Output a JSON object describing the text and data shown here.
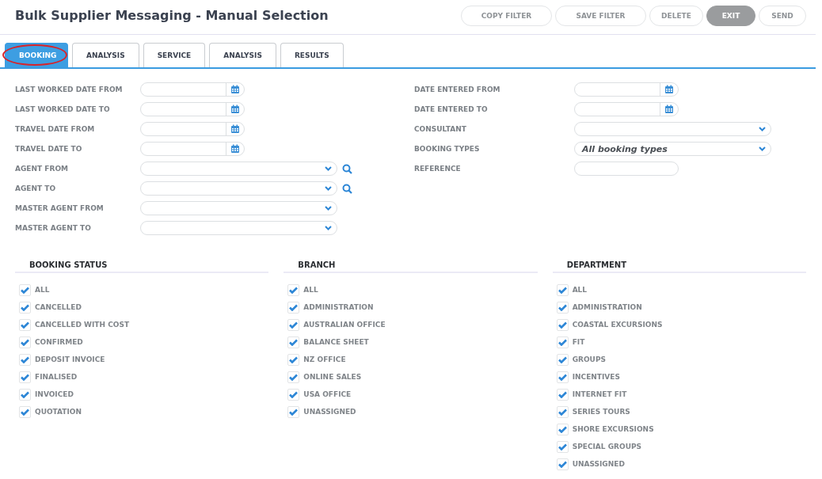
{
  "window": {
    "title": "Bulk Supplier Messaging - Manual Selection"
  },
  "toolbar": [
    {
      "label": "COPY FILTER",
      "kind": "outline"
    },
    {
      "label": "SAVE FILTER",
      "kind": "outline"
    },
    {
      "label": "DELETE",
      "kind": "outline"
    },
    {
      "label": "EXIT",
      "kind": "primary"
    },
    {
      "label": "SEND",
      "kind": "outline"
    }
  ],
  "tabs": [
    {
      "label": "BOOKING",
      "selected": true,
      "circled": true
    },
    {
      "label": "ANALYSIS",
      "selected": false,
      "circled": false
    },
    {
      "label": "SERVICE",
      "selected": false,
      "circled": false
    },
    {
      "label": "ANALYSIS",
      "selected": false,
      "circled": false
    },
    {
      "label": "RESULTS",
      "selected": false,
      "circled": false
    }
  ],
  "form_left": [
    {
      "label": "LAST WORKED DATE FROM",
      "kind": "date"
    },
    {
      "label": "LAST WORKED DATE TO",
      "kind": "date"
    },
    {
      "label": "TRAVEL DATE FROM",
      "kind": "date"
    },
    {
      "label": "TRAVEL DATE TO",
      "kind": "date"
    },
    {
      "label": "AGENT FROM",
      "kind": "lookup"
    },
    {
      "label": "AGENT TO",
      "kind": "lookup"
    },
    {
      "label": "MASTER AGENT FROM",
      "kind": "select"
    },
    {
      "label": "MASTER AGENT TO",
      "kind": "select"
    }
  ],
  "form_right": [
    {
      "label": "DATE ENTERED FROM",
      "kind": "date"
    },
    {
      "label": "DATE ENTERED TO",
      "kind": "date"
    },
    {
      "label": "CONSULTANT",
      "kind": "select"
    },
    {
      "label": "BOOKING TYPES",
      "kind": "select",
      "value": "All booking types"
    },
    {
      "label": "REFERENCE",
      "kind": "text"
    }
  ],
  "groups": [
    {
      "title": "BOOKING STATUS",
      "items": [
        {
          "label": "ALL",
          "checked": true
        },
        {
          "label": "CANCELLED",
          "checked": true
        },
        {
          "label": "CANCELLED WITH COST",
          "checked": true
        },
        {
          "label": "CONFIRMED",
          "checked": true
        },
        {
          "label": "DEPOSIT INVOICE",
          "checked": true
        },
        {
          "label": "FINALISED",
          "checked": true
        },
        {
          "label": "INVOICED",
          "checked": true
        },
        {
          "label": "QUOTATION",
          "checked": true
        }
      ]
    },
    {
      "title": "BRANCH",
      "items": [
        {
          "label": "ALL",
          "checked": true
        },
        {
          "label": "ADMINISTRATION",
          "checked": true
        },
        {
          "label": "AUSTRALIAN OFFICE",
          "checked": true
        },
        {
          "label": "BALANCE SHEET",
          "checked": true
        },
        {
          "label": "NZ OFFICE",
          "checked": true
        },
        {
          "label": "ONLINE SALES",
          "checked": true
        },
        {
          "label": "USA OFFICE",
          "checked": true
        },
        {
          "label": "UNASSIGNED",
          "checked": true
        }
      ]
    },
    {
      "title": "DEPARTMENT",
      "items": [
        {
          "label": "ALL",
          "checked": true
        },
        {
          "label": "ADMINISTRATION",
          "checked": true
        },
        {
          "label": "COASTAL EXCURSIONS",
          "checked": true
        },
        {
          "label": "FIT",
          "checked": true
        },
        {
          "label": "GROUPS",
          "checked": true
        },
        {
          "label": "INCENTIVES",
          "checked": true
        },
        {
          "label": "INTERNET FIT",
          "checked": true
        },
        {
          "label": "SERIES TOURS",
          "checked": true
        },
        {
          "label": "SHORE EXCURSIONS",
          "checked": true
        },
        {
          "label": "SPECIAL GROUPS",
          "checked": true
        },
        {
          "label": "UNASSIGNED",
          "checked": true
        }
      ]
    }
  ]
}
